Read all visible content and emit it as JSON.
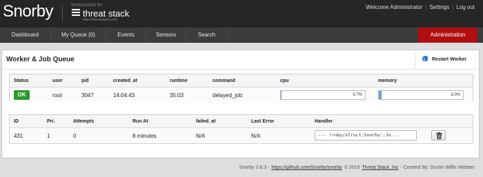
{
  "header": {
    "logo": "Snorby",
    "sponsor_label": "SPONSORED BY",
    "sponsor_name": "threat stack",
    "sponsor_url": "https://threatstack.com",
    "user_nav": {
      "welcome": "Welcome Administrator",
      "separator": "|",
      "settings": "Settings",
      "logout": "Log out"
    }
  },
  "nav": {
    "items": [
      "Dashboard",
      "My Queue (0)",
      "Events",
      "Sensors",
      "Search"
    ],
    "admin": "Administration",
    "admin_color": "#b10f0f"
  },
  "panel": {
    "title": "Worker & Job Queue",
    "restart_label": "Restart Worker",
    "restart_icon": "refresh-icon"
  },
  "worker_table": {
    "headers": [
      "Status",
      "user",
      "pid",
      "created_at",
      "runtime",
      "command",
      "cpu",
      "memory"
    ],
    "row": {
      "status": "OK",
      "user": "root",
      "pid": "3047",
      "created_at": "14:04:43",
      "runtime": "35:03",
      "command": "delayed_job",
      "cpu": "0.7%",
      "cpu_value": 0.7,
      "memory": "3.0%",
      "memory_value": 3.0
    }
  },
  "job_table": {
    "headers": [
      "ID",
      "Pri.",
      "Attempts",
      "Run At",
      "failed_at",
      "Last Error",
      "Handler"
    ],
    "row": {
      "id": "431",
      "priority": "1",
      "attempts": "0",
      "run_at": "8 minutes",
      "failed_at": "N/A",
      "last_error": "N/A",
      "handler": "--- !ruby/struct:Snorby::Jo...",
      "delete_icon": "trash-icon"
    }
  },
  "footer": {
    "version": "Snorby 2.6.3 -",
    "repo_link": "https://github.com/Snorby/snorby",
    "copyright": "© 2016",
    "company": "Threat Stack, Inc",
    "credit": "- Created By: Dustin Willis Webber"
  }
}
